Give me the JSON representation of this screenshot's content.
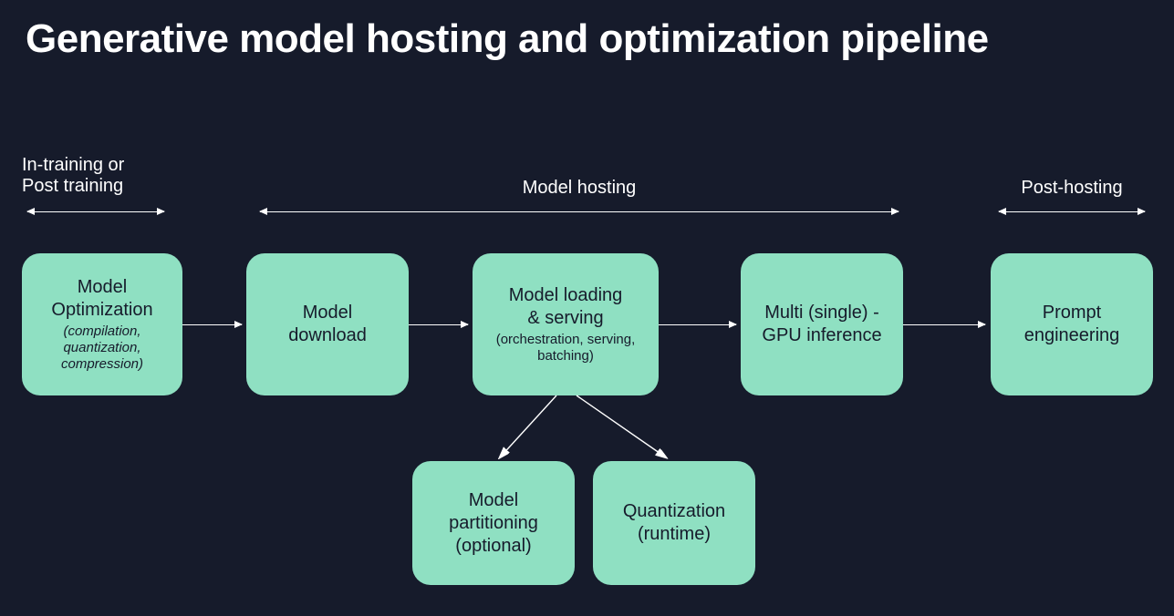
{
  "title": "Generative model hosting and optimization pipeline",
  "sections": {
    "pre": "In-training or\nPost training",
    "hosting": "Model hosting",
    "post": "Post-hosting"
  },
  "boxes": {
    "optimization": {
      "title": "Model\nOptimization",
      "sub": "(compilation,\nquantization,\ncompression)"
    },
    "download": {
      "title": "Model\ndownload"
    },
    "loading": {
      "title": "Model loading\n& serving",
      "sub": "(orchestration, serving,\nbatching)"
    },
    "inference": {
      "title": "Multi (single) -\nGPU inference"
    },
    "prompt": {
      "title": "Prompt\nengineering"
    },
    "partitioning": {
      "title": "Model\npartitioning\n(optional)"
    },
    "quantization": {
      "title": "Quantization\n(runtime)"
    }
  }
}
